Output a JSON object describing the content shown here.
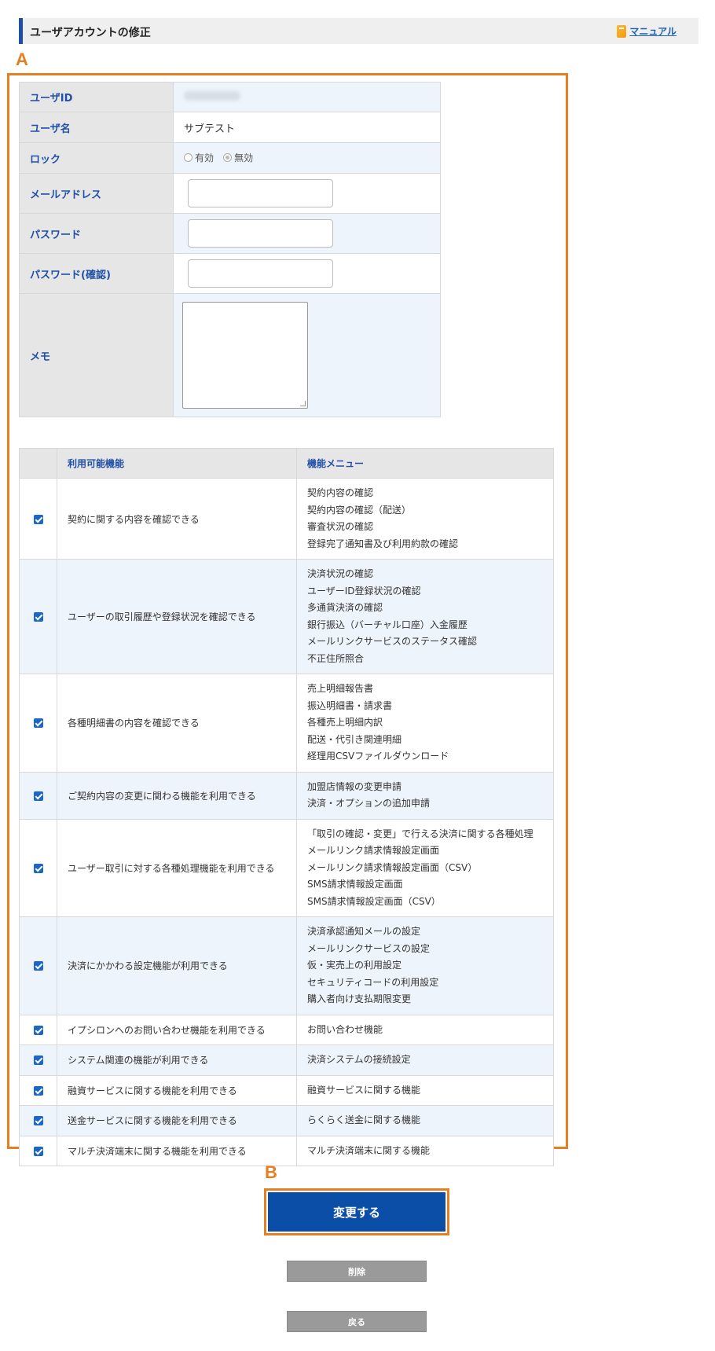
{
  "header": {
    "title": "ユーザアカウントの修正",
    "manual_link": "マニュアル"
  },
  "markers": {
    "a": "A",
    "b": "B"
  },
  "form": {
    "user_id": {
      "label": "ユーザID",
      "value": ""
    },
    "user_name": {
      "label": "ユーザ名",
      "value": "サブテスト"
    },
    "lock": {
      "label": "ロック",
      "options": [
        "有効",
        "無効"
      ],
      "selected": "無効"
    },
    "email": {
      "label": "メールアドレス",
      "value": ""
    },
    "password": {
      "label": "パスワード",
      "value": ""
    },
    "password_confirm": {
      "label": "パスワード(確認)",
      "value": ""
    },
    "memo": {
      "label": "メモ",
      "value": ""
    }
  },
  "functions": {
    "headers": [
      "",
      "利用可能機能",
      "機能メニュー"
    ],
    "rows": [
      {
        "checked": true,
        "feature": "契約に関する内容を確認できる",
        "menu": [
          "契約内容の確認",
          "契約内容の確認（配送）",
          "審査状況の確認",
          "登録完了通知書及び利用約款の確認"
        ]
      },
      {
        "checked": true,
        "feature": "ユーザーの取引履歴や登録状況を確認できる",
        "menu": [
          "決済状況の確認",
          "ユーザーID登録状況の確認",
          "多通貨決済の確認",
          "銀行振込（バーチャル口座）入金履歴",
          "メールリンクサービスのステータス確認",
          "不正住所照合"
        ]
      },
      {
        "checked": true,
        "feature": "各種明細書の内容を確認できる",
        "menu": [
          "売上明細報告書",
          "振込明細書・請求書",
          "各種売上明細内訳",
          "配送・代引き関連明細",
          "経理用CSVファイルダウンロード"
        ]
      },
      {
        "checked": true,
        "feature": "ご契約内容の変更に関わる機能を利用できる",
        "menu": [
          "加盟店情報の変更申請",
          "決済・オプションの追加申請"
        ]
      },
      {
        "checked": true,
        "feature": "ユーザー取引に対する各種処理機能を利用できる",
        "menu": [
          "「取引の確認・変更」で行える決済に関する各種処理",
          "メールリンク請求情報設定画面",
          "メールリンク請求情報設定画面（CSV）",
          "SMS請求情報設定画面",
          "SMS請求情報設定画面（CSV）"
        ]
      },
      {
        "checked": true,
        "feature": "決済にかかわる設定機能が利用できる",
        "menu": [
          "決済承認通知メールの設定",
          "メールリンクサービスの設定",
          "仮・実売上の利用設定",
          "セキュリティコードの利用設定",
          "購入者向け支払期限変更"
        ]
      },
      {
        "checked": true,
        "feature": "イプシロンへのお問い合わせ機能を利用できる",
        "menu": [
          "お問い合わせ機能"
        ]
      },
      {
        "checked": true,
        "feature": "システム関連の機能が利用できる",
        "menu": [
          "決済システムの接続設定"
        ]
      },
      {
        "checked": true,
        "feature": "融資サービスに関する機能を利用できる",
        "menu": [
          "融資サービスに関する機能"
        ]
      },
      {
        "checked": true,
        "feature": "送金サービスに関する機能を利用できる",
        "menu": [
          "らくらく送金に関する機能"
        ]
      },
      {
        "checked": true,
        "feature": "マルチ決済端末に関する機能を利用できる",
        "menu": [
          "マルチ決済端末に関する機能"
        ]
      }
    ]
  },
  "buttons": {
    "submit": "変更する",
    "delete": "削除",
    "back": "戻る"
  },
  "colors": {
    "accent": "#e67e22",
    "primary": "#0b4ea8",
    "label_blue": "#1f4fa8"
  }
}
